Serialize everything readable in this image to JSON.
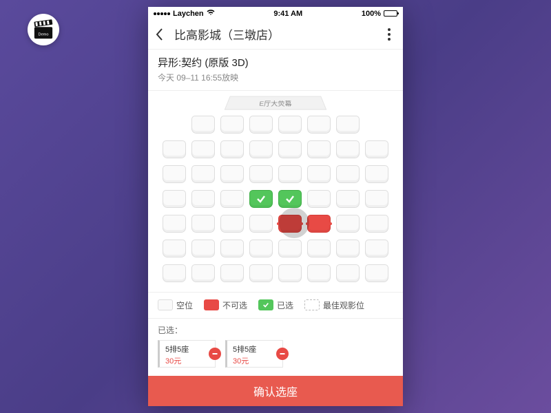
{
  "status": {
    "carrier": "Laychen",
    "time": "9:41 AM",
    "battery": "100%"
  },
  "nav": {
    "title": "比高影城（三墩店）"
  },
  "movie": {
    "name": "异形:契约 (原版 3D)",
    "showtime": "今天 09–11 16:55放映"
  },
  "screen": {
    "label": "E厅大荧幕"
  },
  "seat_layout": {
    "rows": 7,
    "cols": 8,
    "missing": [
      [
        0,
        0
      ],
      [
        0,
        7
      ]
    ],
    "selected": [
      [
        3,
        3
      ],
      [
        3,
        4
      ]
    ],
    "sold": [
      [
        4,
        4
      ],
      [
        4,
        5
      ]
    ]
  },
  "legend": {
    "empty": "空位",
    "sold": "不可选",
    "selected": "已选",
    "best": "最佳观影位"
  },
  "selected": {
    "label": "已选：",
    "tickets": [
      {
        "seat": "5排5座",
        "price": "30元"
      },
      {
        "seat": "5排5座",
        "price": "30元"
      }
    ]
  },
  "confirm": {
    "label": "确认选座"
  },
  "chart_data": {
    "type": "table",
    "title": "Cinema seat map (E厅)",
    "rows": 7,
    "cols": 8,
    "state_counts": {
      "available": 50,
      "selected": 2,
      "sold": 2,
      "no_seat": 2
    },
    "legend": {
      "available": "空位",
      "sold": "不可选",
      "selected": "已选",
      "best": "最佳观影位"
    }
  }
}
